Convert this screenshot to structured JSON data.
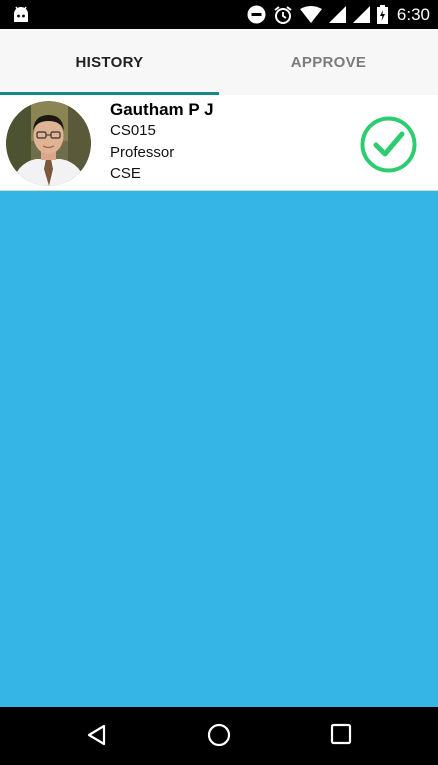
{
  "status_bar": {
    "time": "6:30",
    "icons": [
      "android-icon",
      "do-not-disturb-icon",
      "alarm-icon",
      "wifi-icon",
      "signal-icon",
      "signal-icon",
      "battery-icon"
    ]
  },
  "tabs": [
    {
      "label": "HISTORY",
      "active": true
    },
    {
      "label": "APPROVE",
      "active": false
    }
  ],
  "history": {
    "entries": [
      {
        "name": "Gautham P J",
        "id": "CS015",
        "designation": "Professor",
        "department": "CSE",
        "status_icon": "approved-check-icon",
        "status_color": "#2ecc71"
      }
    ]
  },
  "colors": {
    "background": "#35b5e5",
    "tab_indicator": "#138a89",
    "card": "#ffffff",
    "approved": "#2ecc71"
  },
  "nav_bar": {
    "icons": [
      "back-icon",
      "home-icon",
      "recents-icon"
    ]
  }
}
